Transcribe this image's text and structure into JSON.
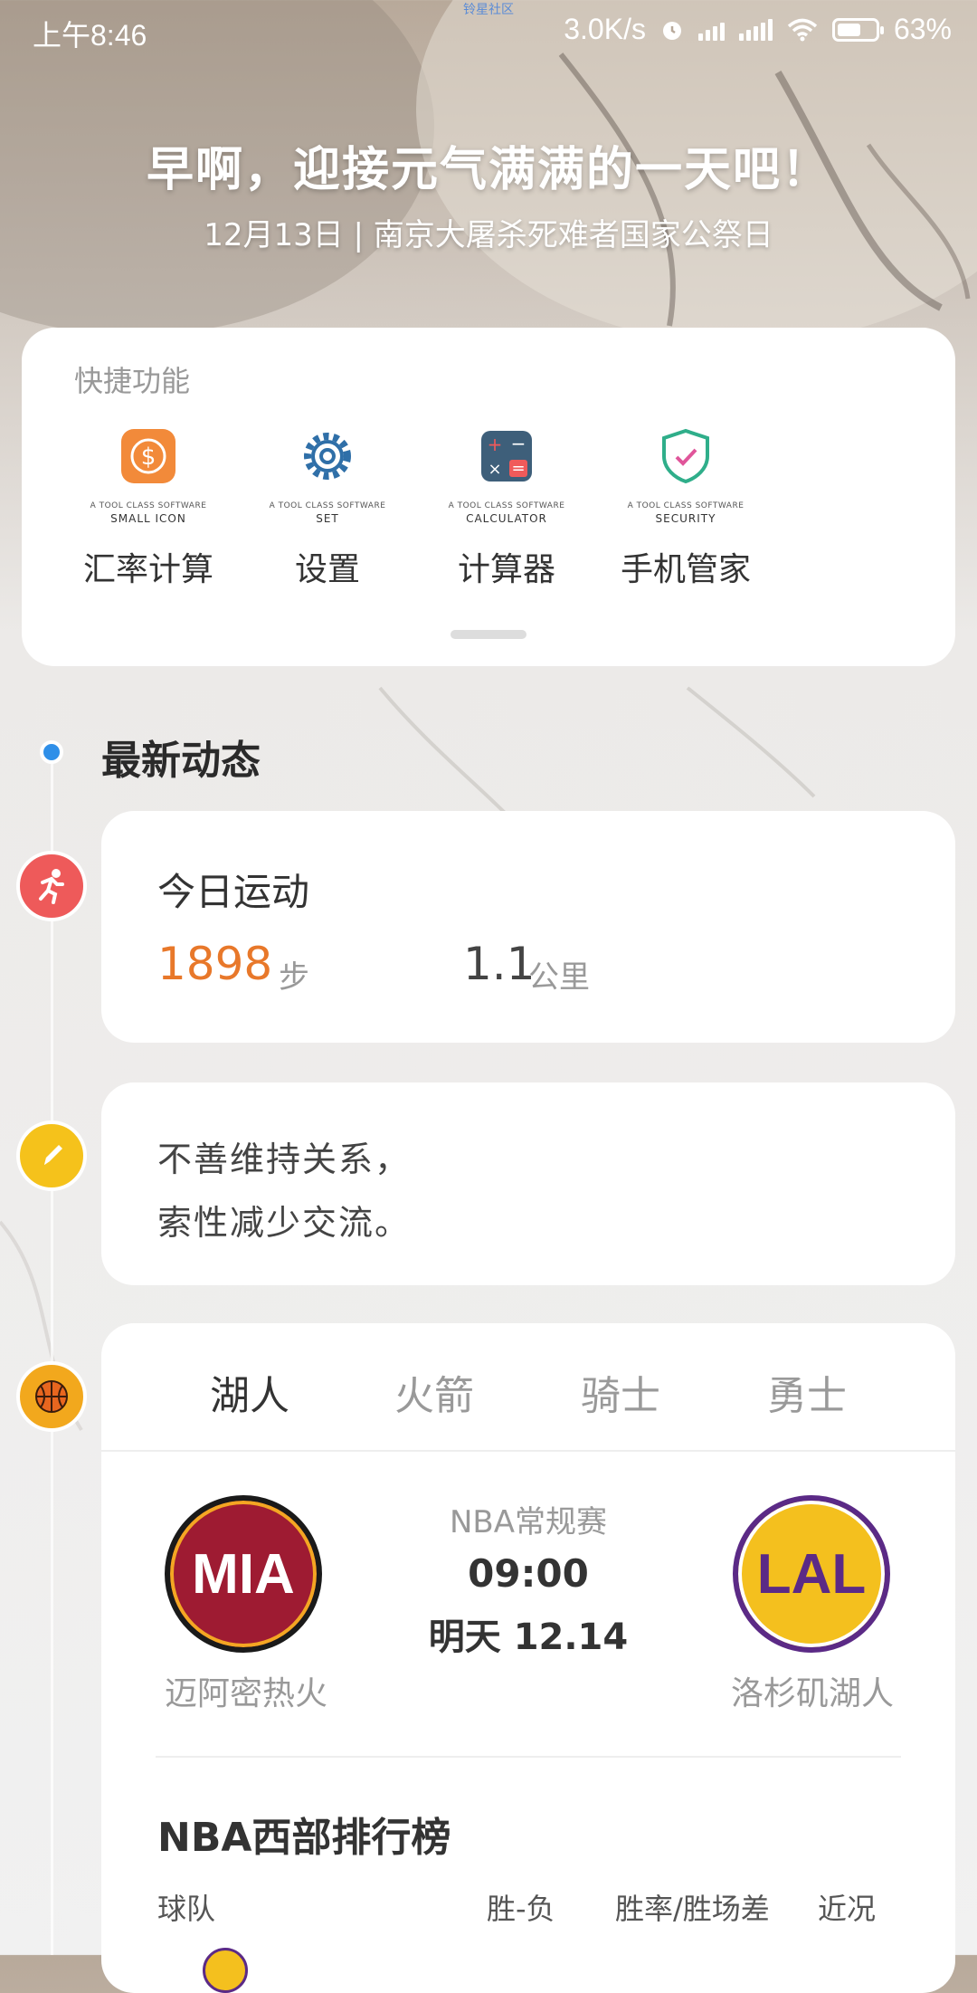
{
  "status_bar": {
    "time": "上午8:46",
    "tiny_text": "铃星社区",
    "net_speed": "3.0K/s",
    "battery": "63%",
    "battery_level": 0.63
  },
  "header": {
    "greeting": "早啊，迎接元气满满的一天吧！",
    "date_line": "12月13日 | 南京大屠杀死难者国家公祭日"
  },
  "quick": {
    "title": "快捷功能",
    "items": [
      {
        "label": "汇率计算",
        "cap1": "A TOOL CLASS SOFTWARE",
        "cap2": "SMALL ICON",
        "icon": "dollar-coin-icon"
      },
      {
        "label": "设置",
        "cap1": "A TOOL CLASS SOFTWARE",
        "cap2": "SET",
        "icon": "gear-icon"
      },
      {
        "label": "计算器",
        "cap1": "A TOOL CLASS SOFTWARE",
        "cap2": "CALCULATOR",
        "icon": "calculator-icon"
      },
      {
        "label": "手机管家",
        "cap1": "A TOOL CLASS SOFTWARE",
        "cap2": "SECURITY",
        "icon": "shield-check-icon"
      }
    ]
  },
  "news": {
    "title": "最新动态"
  },
  "sport": {
    "title": "今日运动",
    "steps": "1898",
    "steps_unit": "步",
    "distance": "1.1",
    "distance_unit": "公里"
  },
  "quote": {
    "line1": "不善维持关系，",
    "line2": "索性减少交流。"
  },
  "nba": {
    "tabs": [
      "湖人",
      "火箭",
      "骑士",
      "勇士"
    ],
    "active_tab": 0,
    "match": {
      "type": "NBA常规赛",
      "time": "09:00",
      "date": "明天 12.14",
      "home": {
        "abbr": "MIA",
        "name": "迈阿密热火",
        "color": "#9e1b32"
      },
      "away": {
        "abbr": "LAL",
        "name": "洛杉矶湖人",
        "color": "#f4c01e"
      }
    },
    "ranking": {
      "title": "NBA西部排行榜",
      "headers": [
        "球队",
        "胜-负",
        "胜率/胜场差",
        "近况"
      ]
    }
  },
  "colors": {
    "accent_orange": "#e8782a",
    "timeline_blue": "#2f8fe8",
    "run_red": "#ee5a5a",
    "pen_yellow": "#f5c21b",
    "ball_orange": "#f2a81d"
  }
}
